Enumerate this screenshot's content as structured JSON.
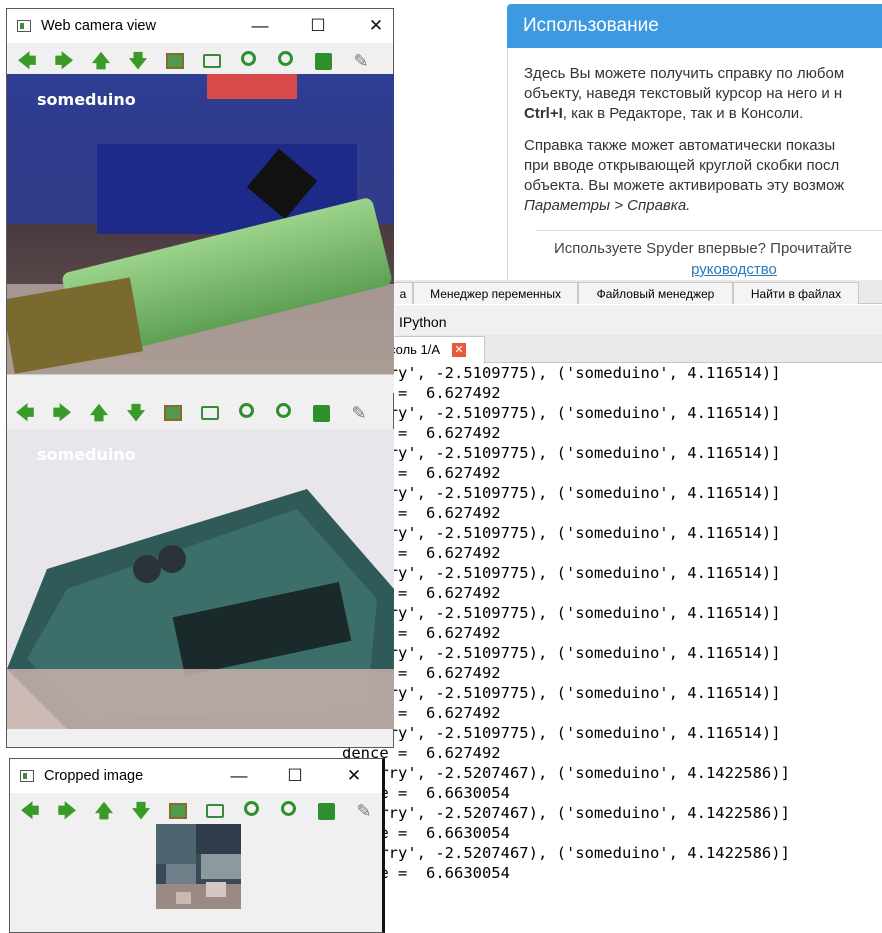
{
  "help": {
    "title": "Использование",
    "para1_line1": "Здесь Вы можете получить справку по любом",
    "para1_line2": "объекту, наведя текстовый курсор на него и н",
    "para1_line3_bold": "Ctrl+I",
    "para1_line3_rest": ", как в Редакторе, так и в Консоли.",
    "para2_line1": "Справка также может автоматически показы",
    "para2_line2": "при вводе открывающей круглой скобки посл",
    "para2_line3": "объекта. Вы можете активировать эту возмож",
    "para2_line4": "Параметры > Справка.",
    "question": "Используете Spyder впервые? Прочитайте",
    "link": "руководство"
  },
  "pane_tabs": [
    "а",
    "Менеджер переменных",
    "Файловый менеджер",
    "Найти в файлах"
  ],
  "ipython_label": "IPython",
  "console_tab": {
    "label": "соль 1/A",
    "close": "✕"
  },
  "console_lines": [
    "spberry', -2.5109775), ('someduino', 4.116514)]",
    "dence =  6.627492",
    "spberry', -2.5109775), ('someduino', 4.116514)]",
    "dence =  6.627492",
    "spberry', -2.5109775), ('someduino', 4.116514)]",
    "dence =  6.627492",
    "spberry', -2.5109775), ('someduino', 4.116514)]",
    "dence =  6.627492",
    "spberry', -2.5109775), ('someduino', 4.116514)]",
    "dence =  6.627492",
    "spberry', -2.5109775), ('someduino', 4.116514)]",
    "dence =  6.627492",
    "spberry', -2.5109775), ('someduino', 4.116514)]",
    "dence =  6.627492",
    "spberry', -2.5109775), ('someduino', 4.116514)]",
    "dence =  6.627492",
    "spberry', -2.5109775), ('someduino', 4.116514)]",
    "dence =  6.627492",
    "spberry', -2.5109775), ('someduino', 4.116514)]",
    "dence =  6.627492",
    "spberry', -2.5207467), ('someduino', 4.1422586)]",
    "dence =  6.6630054",
    "spberry', -2.5207467), ('someduino', 4.1422586)]",
    "dence =  6.6630054",
    "spberry', -2.5207467), ('someduino', 4.1422586)]",
    "dence =  6.6630054"
  ],
  "webcam_window": {
    "title": "Web camera view",
    "minimize": "—",
    "maximize": "☐",
    "close": "✕",
    "overlay_top": "someduino",
    "overlay_bottom": "someduino"
  },
  "cropped_window": {
    "title": "Cropped image",
    "minimize": "—",
    "maximize": "☐",
    "close": "✕"
  },
  "toolbar_icons": [
    "arrow-left-icon",
    "arrow-right-icon",
    "arrow-up-icon",
    "arrow-down-icon",
    "image-icon",
    "fit-icon",
    "zoom-in-icon",
    "zoom-out-icon",
    "save-icon",
    "brush-icon"
  ],
  "colors": {
    "help_header": "#3e9ae0",
    "toolbar_green": "#3a9a28",
    "console_close": "#e9573f"
  }
}
